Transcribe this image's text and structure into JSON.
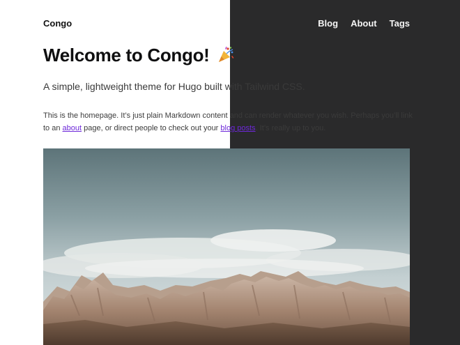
{
  "header": {
    "site_title": "Congo",
    "nav": [
      {
        "label": "Blog"
      },
      {
        "label": "About"
      },
      {
        "label": "Tags"
      }
    ]
  },
  "main": {
    "title": "Welcome to Congo!",
    "lead": "A simple, lightweight theme for Hugo built with Tailwind CSS.",
    "paragraph": {
      "part1": "This is the homepage. It’s just plain Markdown content and can render whatever you wish. Perhaps you’ll link to an ",
      "link_about": "about",
      "part2": " page, or direct people to check out your ",
      "link_blog": "blog posts",
      "part3": ". It’s really up to you."
    }
  },
  "colors": {
    "dark_half": "#2a2a2b",
    "link": "#6d28d9"
  },
  "icons": {
    "title_emoji": "party-popper-icon"
  }
}
